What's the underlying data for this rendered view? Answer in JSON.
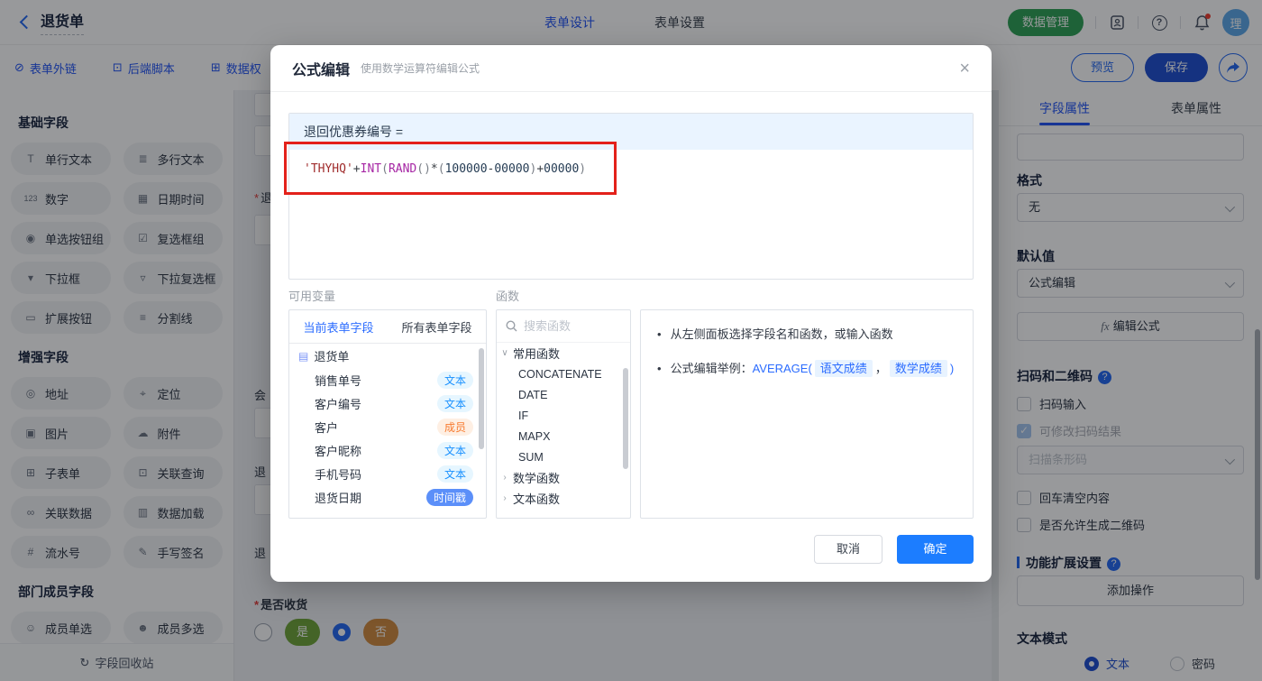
{
  "header": {
    "title": "退货单",
    "tabs": [
      {
        "label": "表单设计"
      },
      {
        "label": "表单设置"
      }
    ],
    "data_manage_button": "数据管理",
    "avatar_text": "理",
    "help_glyph": "?"
  },
  "toolbar": {
    "items": [
      {
        "icon": "⊘",
        "label": "表单外链"
      },
      {
        "icon": "⊡",
        "label": "后端脚本"
      },
      {
        "icon": "⊞",
        "label": "数据权"
      }
    ],
    "preview_button": "预览",
    "save_button": "保存"
  },
  "sidebar": {
    "sections": [
      {
        "title": "基础字段",
        "items": [
          {
            "icon": "T",
            "label": "单行文本"
          },
          {
            "icon": "≣",
            "label": "多行文本"
          },
          {
            "icon": "123",
            "label": "数字"
          },
          {
            "icon": "▦",
            "label": "日期时间"
          },
          {
            "icon": "◉",
            "label": "单选按钮组"
          },
          {
            "icon": "☑",
            "label": "复选框组"
          },
          {
            "icon": "▾",
            "label": "下拉框"
          },
          {
            "icon": "▿",
            "label": "下拉复选框"
          },
          {
            "icon": "▭",
            "label": "扩展按钮"
          },
          {
            "icon": "≡",
            "label": "分割线"
          }
        ]
      },
      {
        "title": "增强字段",
        "items": [
          {
            "icon": "◎",
            "label": "地址"
          },
          {
            "icon": "⌖",
            "label": "定位"
          },
          {
            "icon": "▣",
            "label": "图片"
          },
          {
            "icon": "☁",
            "label": "附件"
          },
          {
            "icon": "⊞",
            "label": "子表单"
          },
          {
            "icon": "⊡",
            "label": "关联查询"
          },
          {
            "icon": "∞",
            "label": "关联数据"
          },
          {
            "icon": "▥",
            "label": "数据加载"
          },
          {
            "icon": "#",
            "label": "流水号"
          },
          {
            "icon": "✎",
            "label": "手写签名"
          }
        ]
      },
      {
        "title": "部门成员字段",
        "items": [
          {
            "icon": "☺",
            "label": "成员单选"
          },
          {
            "icon": "☻",
            "label": "成员多选"
          }
        ]
      }
    ],
    "recycle_bin": {
      "icon": "↻",
      "label": "字段回收站"
    }
  },
  "canvas": {
    "clipped_labels": [
      {
        "required": "*",
        "text": "退"
      },
      {
        "required": "",
        "text": "会"
      },
      {
        "required": "",
        "text": "退"
      },
      {
        "required": "",
        "text": "退"
      }
    ],
    "receipt_field": {
      "required": "*",
      "label": "是否收货",
      "options": [
        {
          "label": "是",
          "color": "#6FA437",
          "selected": false
        },
        {
          "label": "否",
          "color": "#D08A3E",
          "selected": true
        }
      ]
    }
  },
  "modal": {
    "title": "公式编辑",
    "subtitle": "使用数学运算符编辑公式",
    "close_glyph": "×",
    "formula_target": "退回优惠券编号 =",
    "formula_tokens": [
      {
        "t": "'THYHQ'"
      },
      {
        "t": "+"
      },
      {
        "t": "INT"
      },
      {
        "t": "("
      },
      {
        "t": "RAND"
      },
      {
        "t": "()"
      },
      {
        "t": "*"
      },
      {
        "t": "("
      },
      {
        "t": "100000"
      },
      {
        "t": "-"
      },
      {
        "t": "00000"
      },
      {
        "t": ")"
      },
      {
        "t": "+"
      },
      {
        "t": "00000"
      },
      {
        "t": ")"
      }
    ],
    "variables": {
      "label": "可用变量",
      "tabs": [
        {
          "label": "当前表单字段"
        },
        {
          "label": "所有表单字段"
        }
      ],
      "root": "退货单",
      "fields": [
        {
          "name": "销售单号",
          "type": "文本"
        },
        {
          "name": "客户编号",
          "type": "文本"
        },
        {
          "name": "客户",
          "type": "成员"
        },
        {
          "name": "客户昵称",
          "type": "文本"
        },
        {
          "name": "手机号码",
          "type": "文本"
        },
        {
          "name": "退货日期",
          "type": "时间戳"
        }
      ]
    },
    "functions": {
      "label": "函数",
      "search_placeholder": "搜索函数",
      "group_common": {
        "caret": "∨",
        "name": "常用函数"
      },
      "items": [
        "CONCATENATE",
        "DATE",
        "IF",
        "MAPX",
        "SUM"
      ],
      "group_math": {
        "caret": "›",
        "name": "数学函数"
      },
      "group_text": {
        "caret": "›",
        "name": "文本函数"
      }
    },
    "help": {
      "line1": "从左侧面板选择字段名和函数，或输入函数",
      "line2_prefix": "公式编辑举例：",
      "func_open": "AVERAGE(",
      "pill1": "语文成绩",
      "comma": "，",
      "pill2": "数学成绩",
      "func_close": ")"
    },
    "cancel_button": "取消",
    "confirm_button": "确定"
  },
  "properties": {
    "tabs": [
      {
        "label": "字段属性"
      },
      {
        "label": "表单属性"
      }
    ],
    "format_label": "格式",
    "format_value": "无",
    "default_label": "默认值",
    "default_value": "公式编辑",
    "fx_glyph": "fx",
    "edit_formula_button": "编辑公式",
    "scan_section": "扫码和二维码",
    "qmark": "?",
    "cb_scan_input": "扫码输入",
    "cb_editable_result": "可修改扫码结果",
    "barcode_select": "扫描条形码",
    "cb_enter_clear": "回车清空内容",
    "cb_allow_qrcode": "是否允许生成二维码",
    "ext_section": "功能扩展设置",
    "add_action_button": "添加操作",
    "text_mode_label": "文本模式",
    "radio_text": "文本",
    "radio_password": "密码"
  },
  "colors": {
    "brand_blue": "#2254F4",
    "confirm_blue": "#1C7DFF",
    "green": "#2EA155",
    "yes_green": "#6FA437",
    "no_orange": "#D08A3E",
    "badge_text_blue": "#1890FF",
    "badge_member_orange": "#F87B2F",
    "badge_time_blue": "#5B8FF9",
    "annotation_red": "#E3211A"
  }
}
